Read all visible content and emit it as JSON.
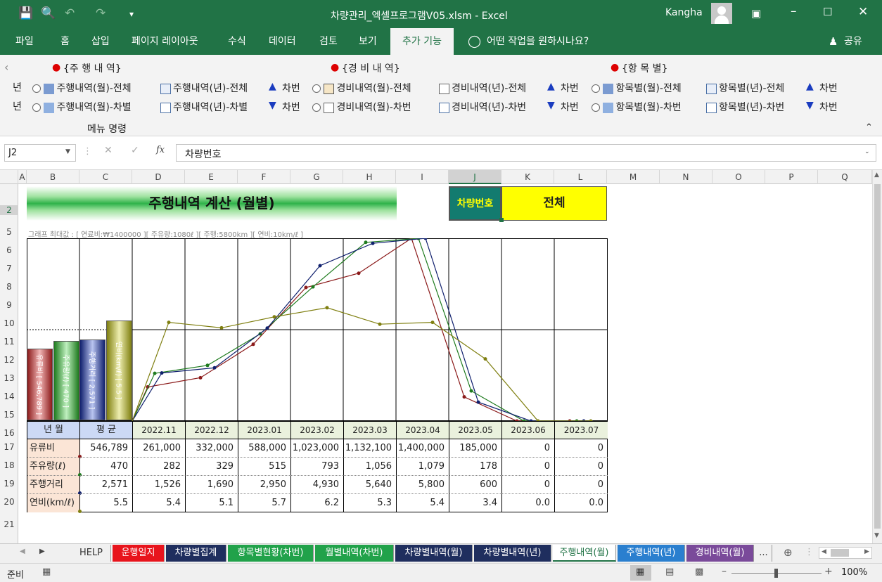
{
  "window": {
    "title": "차량관리_엑셀프로그램V05.xlsm  -  Excel",
    "user": "Kangha"
  },
  "menu": [
    "파일",
    "홈",
    "삽입",
    "페이지 레이아웃",
    "수식",
    "데이터",
    "검토",
    "보기",
    "추가 기능"
  ],
  "tellme": "어떤 작업을 원하시나요?",
  "share": "공유",
  "ribbon": {
    "group1": {
      "title": "{주 행 내 역}",
      "b1": "주행내역(월)-전체",
      "b2": "주행내역(년)-전체",
      "b3": "주행내역(월)-차별",
      "b4": "주행내역(년)-차별",
      "up": "차번",
      "down": "차번"
    },
    "group2": {
      "title": "{경 비 내 역}",
      "b1": "경비내역(월)-전체",
      "b2": "경비내역(년)-전체",
      "b3": "경비내역(월)-차번",
      "b4": "경비내역(년)-차번",
      "up": "차번",
      "down": "차번"
    },
    "group3": {
      "title": "{항 목 별}",
      "b1": "항목별(월)-전체",
      "b2": "항목별(년)-전체",
      "b3": "항목별(월)-차번",
      "b4": "항목별(년)-차번",
      "up": "차번",
      "down": "차번"
    },
    "left_clip": "년",
    "caption": "메뉴 명령"
  },
  "formula": {
    "namebox": "J2",
    "fx": "fx",
    "value": "차량번호"
  },
  "columns": [
    "A",
    "B",
    "C",
    "D",
    "E",
    "F",
    "G",
    "H",
    "I",
    "J",
    "K",
    "L",
    "M",
    "N",
    "O",
    "P",
    "Q"
  ],
  "rows": [
    "2",
    "5",
    "6",
    "7",
    "8",
    "9",
    "10",
    "11",
    "12",
    "13",
    "14",
    "15",
    "16",
    "17",
    "18",
    "19",
    "20",
    "21"
  ],
  "sheet": {
    "title": "주행내역 계산 (월별)",
    "car_label": "차량번호",
    "car_value": "전체",
    "graph_note": "그래프 최대값 : [ 연료비:₩1400000 ][ 주유량:1080ℓ ][ 주행:5800km ][ 연비:10km/ℓ ]",
    "hdr_month": "년 월",
    "hdr_avg": "평 균",
    "months": [
      "2022.11",
      "2022.12",
      "2023.01",
      "2023.02",
      "2023.03",
      "2023.04",
      "2023.05",
      "2023.06",
      "2023.07"
    ],
    "table": [
      {
        "label": "유류비",
        "avg": "546,789",
        "vals": [
          "261,000",
          "332,000",
          "588,000",
          "1,023,000",
          "1,132,100",
          "1,400,000",
          "185,000",
          "0",
          "0"
        ]
      },
      {
        "label": "주유량(ℓ)",
        "avg": "470",
        "vals": [
          "282",
          "329",
          "515",
          "793",
          "1,056",
          "1,079",
          "178",
          "0",
          "0"
        ]
      },
      {
        "label": "주행거리",
        "avg": "2,571",
        "vals": [
          "1,526",
          "1,690",
          "2,950",
          "4,930",
          "5,640",
          "5,800",
          "600",
          "0",
          "0"
        ]
      },
      {
        "label": "연비(km/ℓ)",
        "avg": "5.5",
        "vals": [
          "5.4",
          "5.1",
          "5.7",
          "6.2",
          "5.3",
          "5.4",
          "3.4",
          "0.0",
          "0.0"
        ]
      }
    ],
    "avg_bars": [
      "유류비 [ 546,789 ]",
      "주유량(ℓ) [ 470 ]",
      "주행거리 [ 2,571 ]",
      "연비(km/ℓ) [ 5.5 ]"
    ]
  },
  "chart_data": {
    "type": "line",
    "categories": [
      "2022.11",
      "2022.12",
      "2023.01",
      "2023.02",
      "2023.03",
      "2023.04",
      "2023.05",
      "2023.06",
      "2023.07"
    ],
    "series": [
      {
        "name": "유류비",
        "color": "#8b1a1a",
        "max": 1400000,
        "values": [
          261000,
          332000,
          588000,
          1023000,
          1132100,
          1400000,
          185000,
          0,
          0
        ]
      },
      {
        "name": "주유량(ℓ)",
        "color": "#1e7b1e",
        "max": 1080,
        "values": [
          282,
          329,
          515,
          793,
          1056,
          1079,
          178,
          0,
          0
        ]
      },
      {
        "name": "주행거리",
        "color": "#10206e",
        "max": 5800,
        "values": [
          1526,
          1690,
          2950,
          4930,
          5640,
          5800,
          600,
          0,
          0
        ]
      },
      {
        "name": "연비(km/ℓ)",
        "color": "#7f7f10",
        "max": 10,
        "values": [
          5.4,
          5.1,
          5.7,
          6.2,
          5.3,
          5.4,
          3.4,
          0.0,
          0.0
        ]
      }
    ],
    "avg": {
      "유류비": 546789,
      "주유량(ℓ)": 470,
      "주행거리": 2571,
      "연비(km/ℓ)": 5.5
    }
  },
  "tabs": [
    "HELP",
    "운행일지",
    "차량별집계",
    "항목별현황(차번)",
    "월별내역(차번)",
    "차량별내역(월)",
    "차량별내역(년)",
    "주행내역(월)",
    "주행내역(년)",
    "경비내역(월)",
    "..."
  ],
  "tab_colors": [
    "#f0f0f0",
    "#e8141c",
    "#1f2e5e",
    "#21a24a",
    "#21a24a",
    "#1f2e5e",
    "#1f2e5e",
    "#dff0f7",
    "#2a7fcf",
    "#7a4a9a",
    "#f0f0f0"
  ],
  "status": {
    "ready": "준비",
    "zoom": "100%"
  }
}
